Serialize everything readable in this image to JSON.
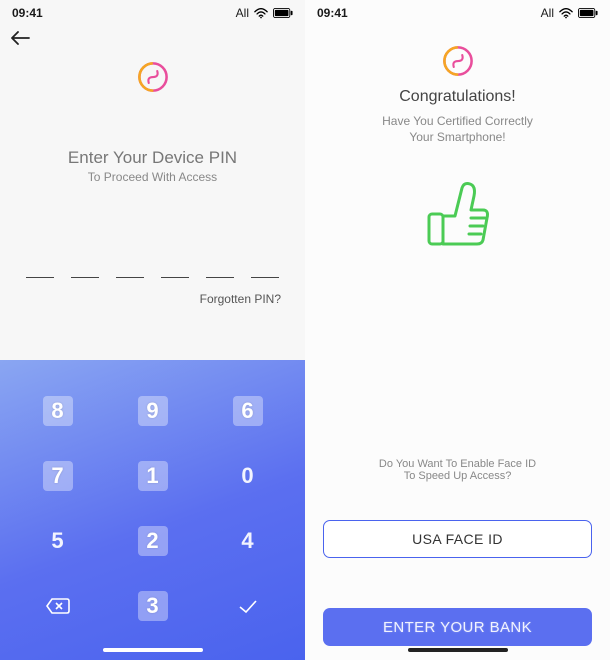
{
  "status": {
    "time": "09:41",
    "carrier": "All"
  },
  "logo": {
    "colors": {
      "a": "#e94e9c",
      "b": "#f5a623"
    }
  },
  "pin_screen": {
    "title": "Enter Your Device PIN",
    "subtitle": "To Proceed With Access",
    "forgotten": "Forgotten PIN?",
    "digits_count": 6,
    "keypad": {
      "r1": [
        "8",
        "9",
        "6"
      ],
      "r2": [
        "7",
        "1",
        "0"
      ],
      "r3": [
        "5",
        "2",
        "4"
      ],
      "r4_mid": "3"
    }
  },
  "congrats_screen": {
    "title": "Congratulations!",
    "line1": "Have You Certified Correctly",
    "line2": "Your Smartphone!",
    "faceid_q1": "Do You Want To Enable Face ID",
    "faceid_q2": "To Speed Up Access?",
    "btn_faceid": "USA FACE ID",
    "btn_bank": "ENTER YOUR BANK"
  },
  "thumb_color": "#4bcb55"
}
